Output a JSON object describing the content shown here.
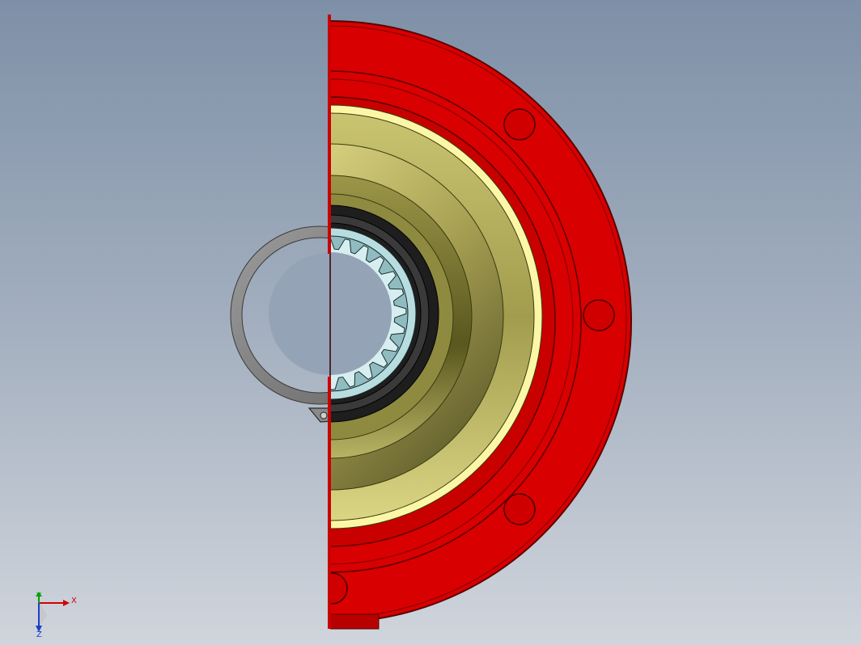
{
  "triad": {
    "x_label": "X",
    "y_label": "Y",
    "z_label": "Z"
  },
  "colors": {
    "background_top": "#7e90a7",
    "background_bottom": "#d0d5dc",
    "housing_red": "#d40000",
    "housing_edge": "#6a0000",
    "bearing_olive": "#a7a255",
    "bearing_yellow": "#f2ee8e",
    "seal_dark": "#2a2a2a",
    "spline_teal": "#a6d0d4",
    "snap_ring_gray": "#8a8a8a",
    "axis_x": "#d40000",
    "axis_y": "#00a000",
    "axis_z": "#1a40c8"
  },
  "model_parts": [
    "flange-housing",
    "bearing-rings",
    "oil-seal",
    "splined-hub",
    "snap-ring"
  ]
}
